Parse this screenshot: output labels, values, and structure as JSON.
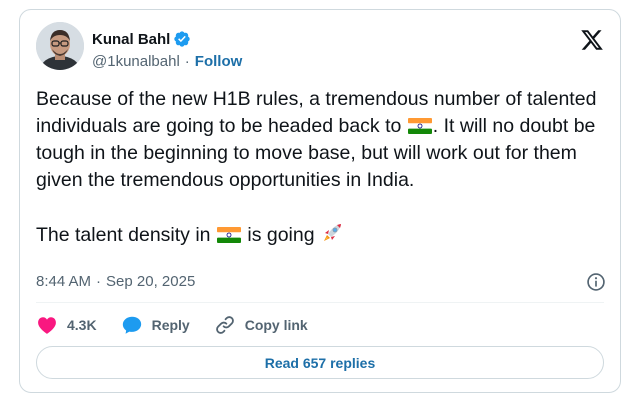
{
  "author": {
    "display_name": "Kunal Bahl",
    "handle": "@1kunalbahl",
    "separator": "·",
    "follow_label": "Follow"
  },
  "tweet": {
    "text_part1": "Because of the new H1B rules, a tremendous number of talented individuals are going to be headed back to ",
    "text_part2": ". It will no doubt be tough in the beginning to move base, but will work out for them given the tremendous opportunities in India.",
    "text_part3": "The talent density in ",
    "text_part4": " is going ",
    "emoji": [
      "india-flag-icon",
      "india-flag-icon",
      "rocket-icon"
    ]
  },
  "meta": {
    "time": "8:44 AM",
    "separator": "·",
    "date": "Sep 20, 2025"
  },
  "actions": {
    "like_count": "4.3K",
    "reply_label": "Reply",
    "copy_link_label": "Copy link"
  },
  "read_replies_label": "Read 657 replies",
  "colors": {
    "link_blue": "#1d6fa8",
    "verified_blue": "#1d9bf0",
    "like_pink": "#f91880",
    "reply_blue": "#1d9bf0",
    "muted": "#536471",
    "border": "#cfd9de"
  }
}
